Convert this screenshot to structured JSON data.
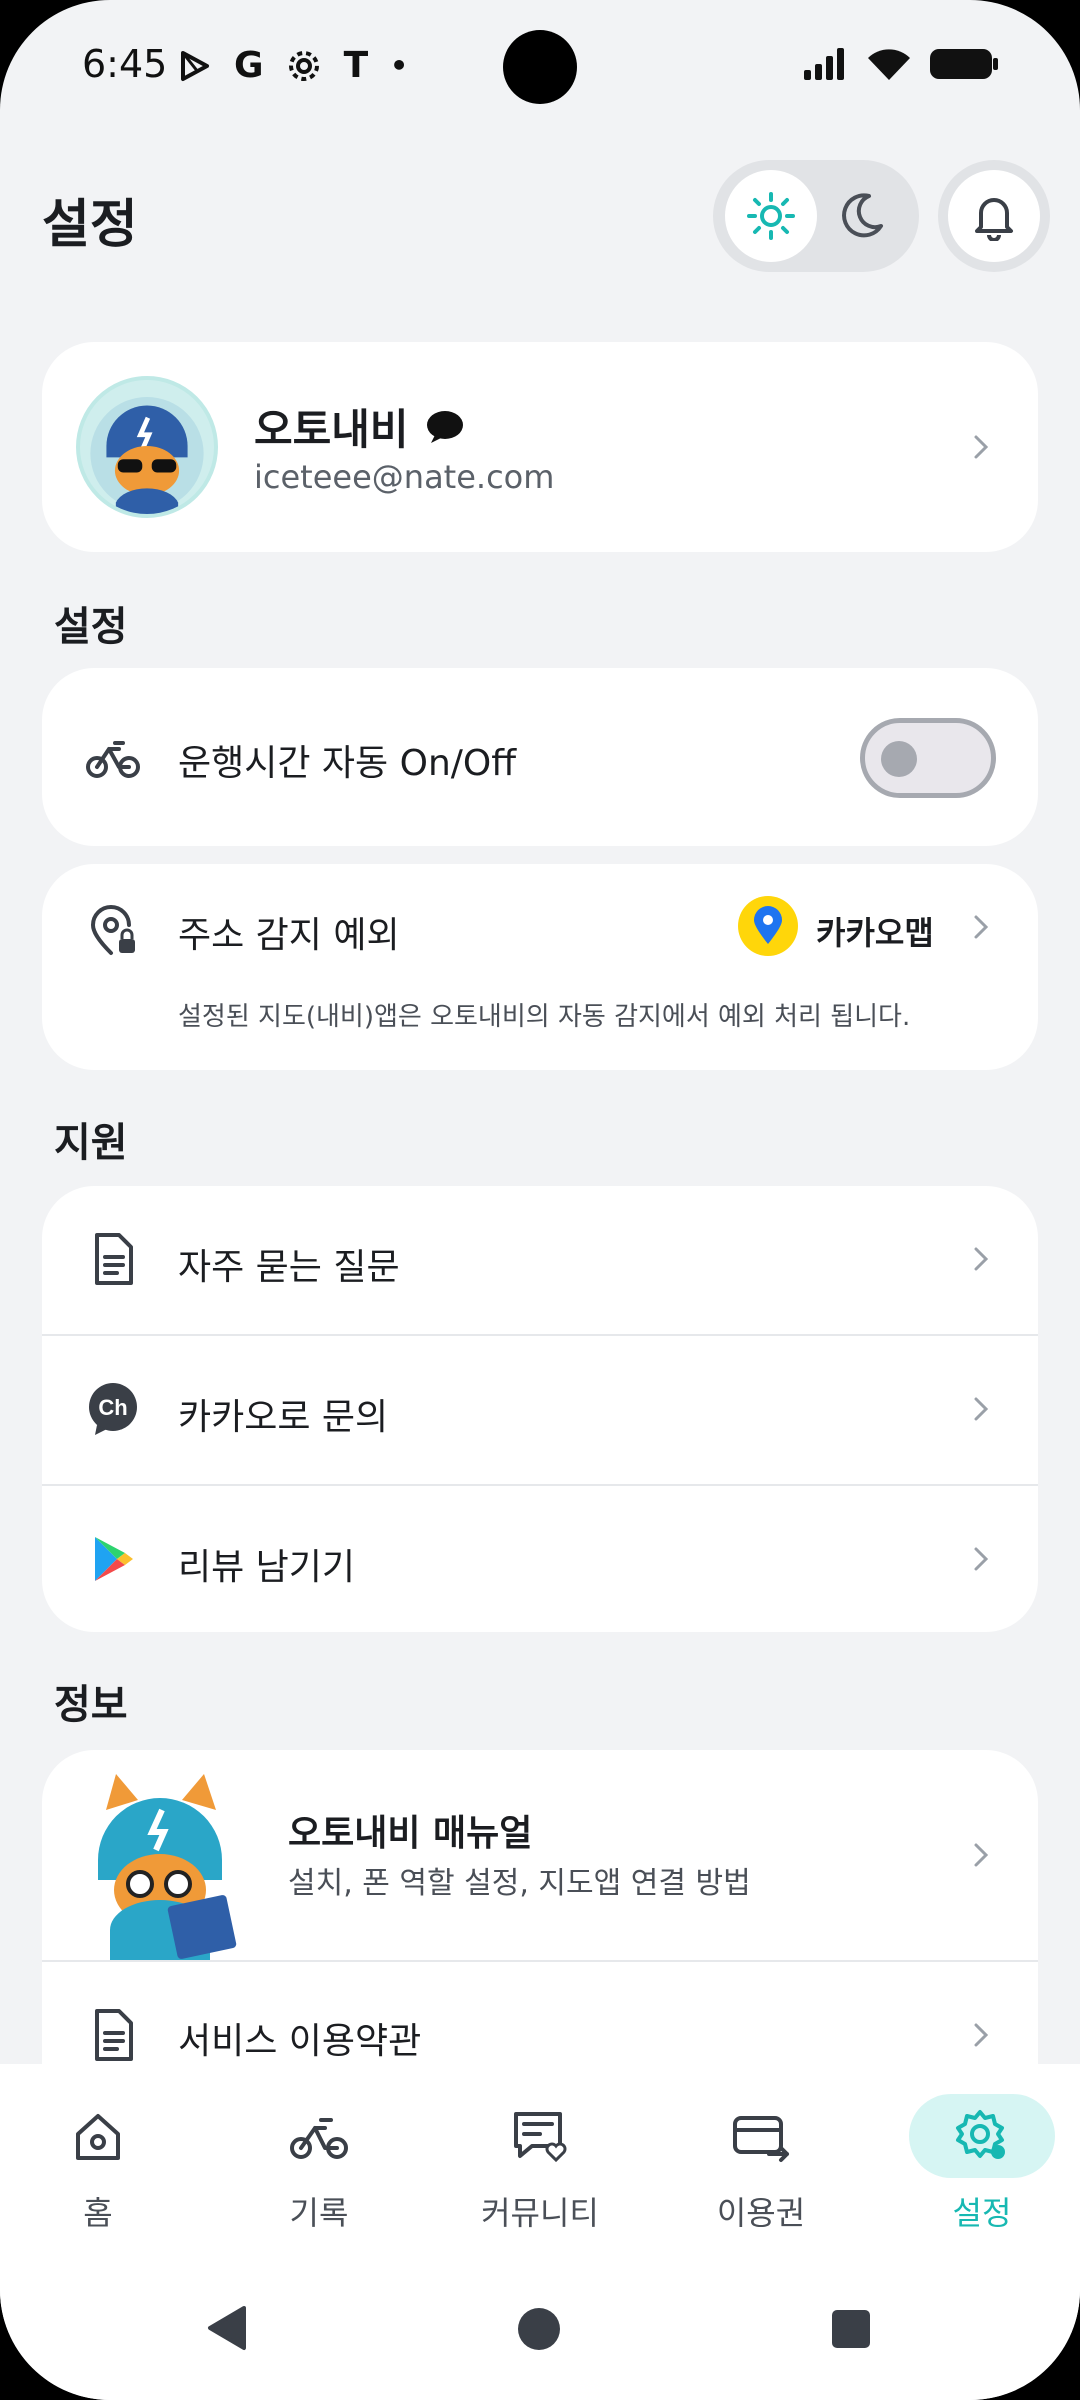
{
  "status_bar": {
    "time": "6:45",
    "notification_icons": [
      "play-icon",
      "G",
      "gear-icon",
      "T",
      "•"
    ]
  },
  "header": {
    "title": "설정",
    "theme": {
      "light_icon": "sun-icon",
      "dark_icon": "moon-icon",
      "selected": "light"
    },
    "notification_icon": "bell-icon"
  },
  "profile": {
    "name": "오토내비",
    "email": "iceteee@nate.com"
  },
  "sections": {
    "settings_title": "설정",
    "support_title": "지원",
    "info_title": "정보"
  },
  "settings": {
    "auto_onoff_label": "운행시간 자동 On/Off",
    "auto_onoff_enabled": false,
    "address_label": "주소 감지 예외",
    "address_app": "카카오맵",
    "address_desc": "설정된 지도(내비)앱은 오토내비의 자동 감지에서 예외 처리 됩니다."
  },
  "support": {
    "items": [
      {
        "label": "자주 묻는 질문",
        "icon": "document-icon"
      },
      {
        "label": "카카오로 문의",
        "icon": "kakao-channel-icon"
      },
      {
        "label": "리뷰 남기기",
        "icon": "google-play-icon"
      }
    ]
  },
  "info": {
    "manual_title": "오토내비 매뉴얼",
    "manual_subtitle": "설치, 폰 역할 설정, 지도앱 연결 방법",
    "terms_label": "서비스 이용약관"
  },
  "bottom_nav": {
    "items": [
      {
        "label": "홈",
        "icon": "home-icon"
      },
      {
        "label": "기록",
        "icon": "bike-icon"
      },
      {
        "label": "커뮤니티",
        "icon": "community-icon"
      },
      {
        "label": "이용권",
        "icon": "ticket-icon"
      },
      {
        "label": "설정",
        "icon": "settings-icon",
        "active": true
      }
    ]
  },
  "colors": {
    "accent": "#17b8b2",
    "background": "#f2f3f5",
    "card": "#ffffff"
  }
}
